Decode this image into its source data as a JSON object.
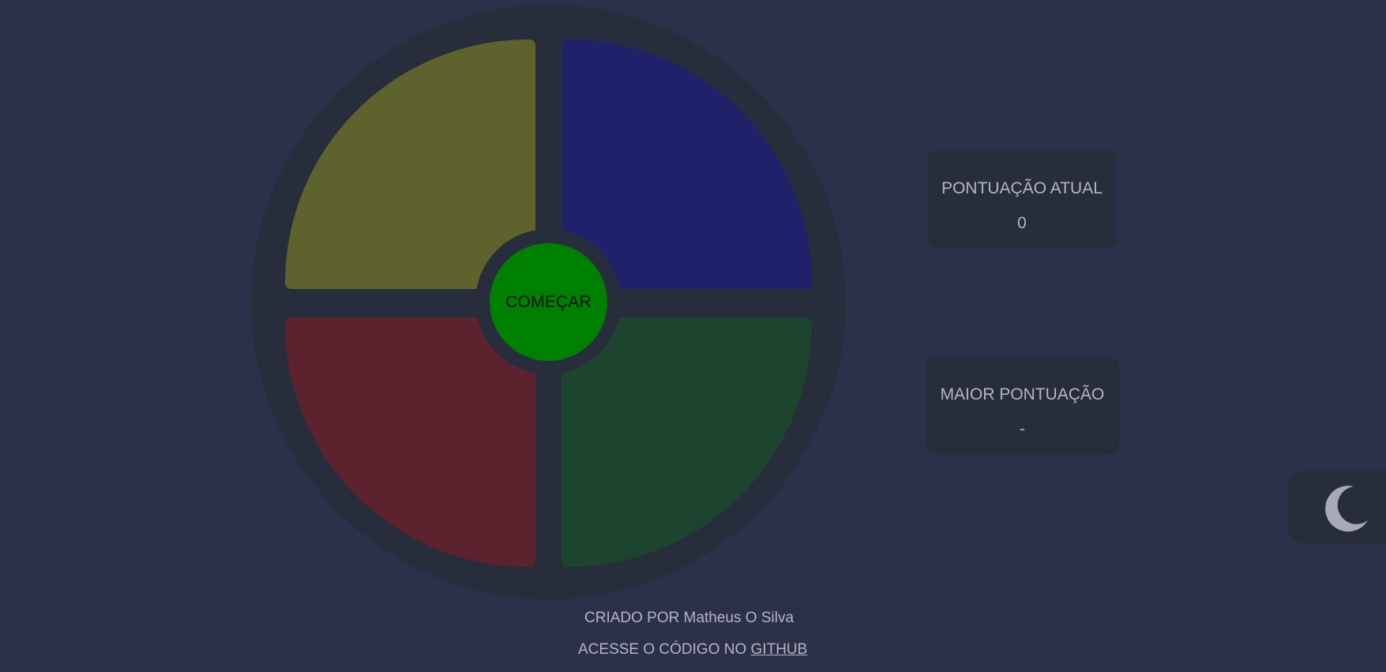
{
  "game": {
    "start_label": "COMEÇAR",
    "pads": [
      {
        "name": "yellow",
        "color": "#5e632e"
      },
      {
        "name": "blue",
        "color": "#1f216b"
      },
      {
        "name": "red",
        "color": "#5c232e"
      },
      {
        "name": "green",
        "color": "#1d442e"
      }
    ],
    "start_color": "#008000"
  },
  "scores": {
    "current_title": "PONTUAÇÃO ATUAL",
    "current_value": "0",
    "best_title": "MAIOR PONTUAÇÃO",
    "best_value": "-"
  },
  "theme_toggle": {
    "icon": "moon-icon"
  },
  "footer": {
    "created_by": "CRIADO POR Matheus O Silva",
    "code_prefix": "ACESSE O CÓDIGO NO ",
    "github_label": "GITHUB"
  },
  "colors": {
    "background": "#2c3048",
    "panel": "#282d3c",
    "text": "#b4b6c0"
  }
}
